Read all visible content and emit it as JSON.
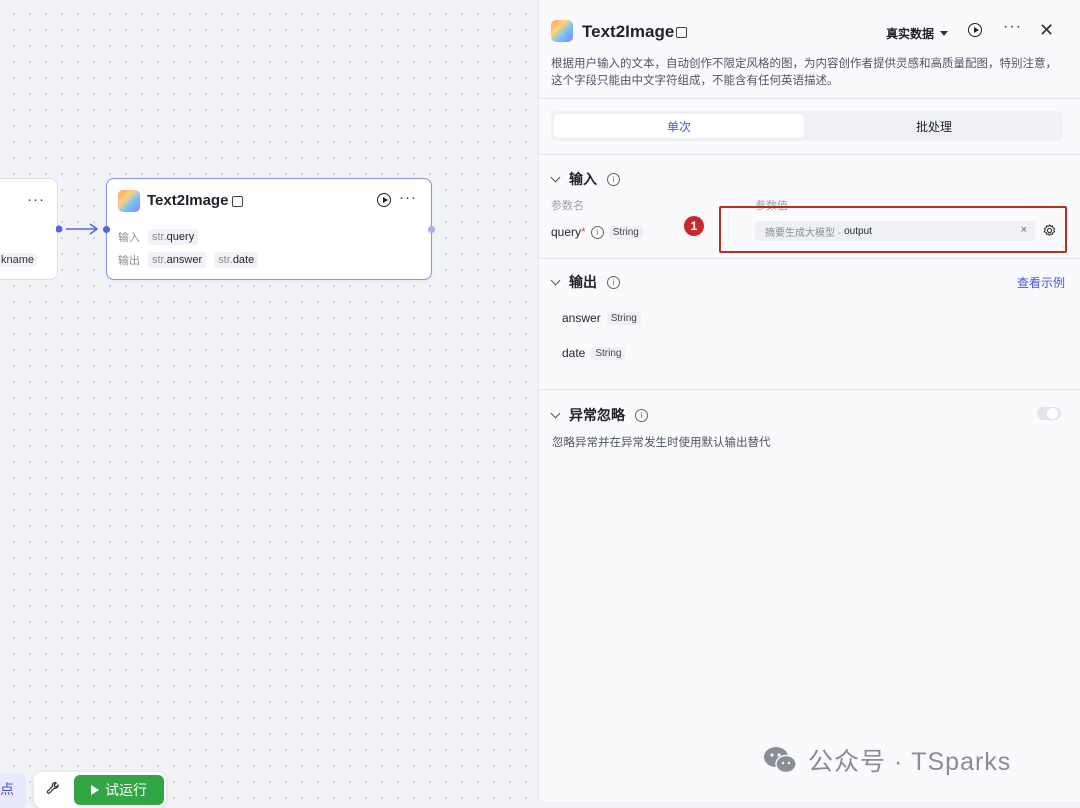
{
  "canvas": {
    "prev_node": {
      "more_label": "···",
      "tag_label": "kname"
    },
    "node": {
      "title": "Text2Image",
      "more_label": "···",
      "input_label": "输入",
      "output_label": "输出",
      "inputs": [
        {
          "type": "str.",
          "name": "query"
        }
      ],
      "outputs": [
        {
          "type": "str.",
          "name": "answer"
        },
        {
          "type": "str.",
          "name": "date"
        }
      ]
    },
    "left_button_label": "点",
    "test_run_label": "试运行"
  },
  "panel": {
    "title": "Text2Image",
    "data_select_label": "真实数据",
    "more_label": "···",
    "close_label": "✕",
    "description": "根据用户输入的文本，自动创作不限定风格的图，为内容创作者提供灵感和高质量配图，特别注意，这个字段只能由中文字符组成，不能含有任何英语描述。",
    "tabs": [
      {
        "label": "单次"
      },
      {
        "label": "批处理"
      }
    ],
    "input_section": {
      "title": "输入",
      "col_name": "参数名",
      "col_value": "参数值",
      "param": {
        "name": "query",
        "required_mark": "*",
        "type": "String"
      },
      "annotation_number": "1",
      "ref_source": "摘要生成大模型 -",
      "ref_field": "output",
      "clear_label": "×"
    },
    "output_section": {
      "title": "输出",
      "example_link": "查看示例",
      "items": [
        {
          "name": "answer",
          "type": "String"
        },
        {
          "name": "date",
          "type": "String"
        }
      ]
    },
    "ignore_section": {
      "title": "异常忽略",
      "description": "忽略异常并在异常发生时使用默认输出替代",
      "enabled": false
    }
  },
  "watermark": {
    "text": "公众号 · TSparks"
  },
  "colors": {
    "accent": "#4953d8",
    "run_green": "#32a645",
    "highlight_red": "#b23124"
  }
}
